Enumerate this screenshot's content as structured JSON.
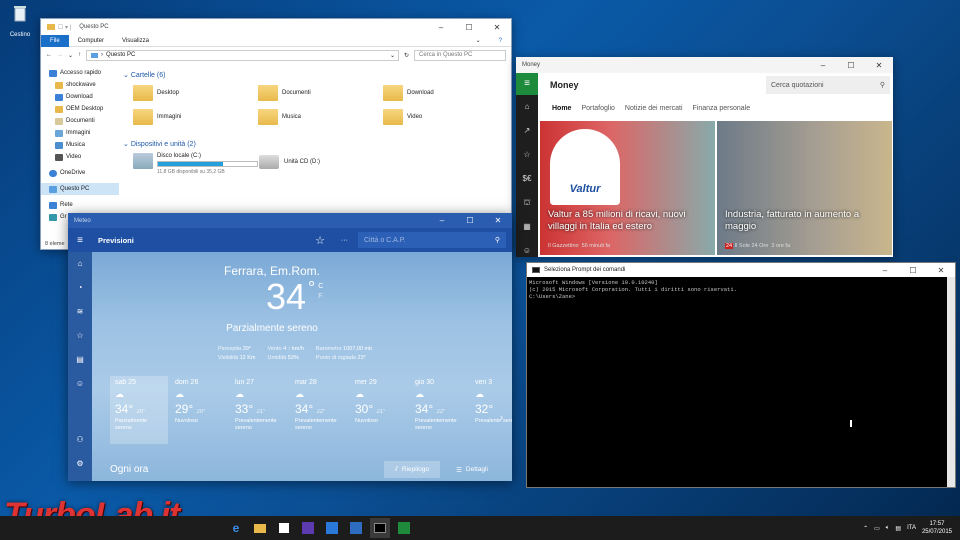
{
  "desktop": {
    "recycle_label": "Cestino"
  },
  "explorer": {
    "title": "Questo PC",
    "tabs": [
      "File",
      "Computer",
      "Visualizza"
    ],
    "address": "Questo PC",
    "search_placeholder": "Cerca in Questo PC",
    "nav": [
      "Accesso rapido",
      "shockwave",
      "Download",
      "OEM Desktop",
      "Documenti",
      "Immagini",
      "Musica",
      "Video",
      "OneDrive",
      "Questo PC",
      "Rete",
      "Gr"
    ],
    "folders_header": "Cartelle (6)",
    "folders": [
      "Desktop",
      "Documenti",
      "Download",
      "Immagini",
      "Musica",
      "Video"
    ],
    "devices_header": "Dispositivi e unità (2)",
    "disk_name": "Disco locale (C:)",
    "disk_space": "11,8 GB disponibili su 35,2 GB",
    "disk_fill": 0.66,
    "cd_name": "Unità CD (D:)",
    "status": "8 eleme"
  },
  "money": {
    "title": "Money",
    "app": "Money",
    "search_placeholder": "Cerca quotazioni",
    "tabs": [
      "Home",
      "Portafoglio",
      "Notizie dei mercati",
      "Finanza personale"
    ],
    "tile1": {
      "caption": "Valtur a 85 milioni di ricavi, nuovi villaggi in Italia ed estero",
      "source": "Il Gazzettino",
      "time": "56 minuti fa",
      "logo_text": "Valtur"
    },
    "tile2": {
      "caption": "Industria, fatturato in aumento a maggio",
      "source": "Il Sole 24 Ore",
      "time": "3 ore fa",
      "badge": "24"
    }
  },
  "meteo": {
    "title": "Meteo",
    "header": "Previsioni",
    "search_placeholder": "Città o C.A.P.",
    "city": "Ferrara, Em.Rom.",
    "temp": "34",
    "deg": "°",
    "unit_c": "C",
    "unit_f": "F",
    "condition": "Parzialmente sereno",
    "details": {
      "perceived_label": "Percepita",
      "perceived": "39°",
      "wind_label": "Vento",
      "wind": "4 ↑ km/h",
      "barometer_label": "Barometro",
      "barometer": "1007,00 mb",
      "visibility_label": "Visibilità",
      "visibility": "12 Km",
      "humidity_label": "Umidità",
      "humidity": "53%",
      "dew_label": "Punto di rugiada",
      "dew": "23°"
    },
    "days": [
      {
        "name": "sab 25",
        "hi": "34°",
        "lo": "20°",
        "cond": "Parzialmente sereno"
      },
      {
        "name": "dom 26",
        "hi": "29°",
        "lo": "20°",
        "cond": "Nuvoloso"
      },
      {
        "name": "lun 27",
        "hi": "33°",
        "lo": "21°",
        "cond": "Prevalentemente sereno"
      },
      {
        "name": "mar 28",
        "hi": "34°",
        "lo": "22°",
        "cond": "Prevalentemente sereno"
      },
      {
        "name": "mer 29",
        "hi": "30°",
        "lo": "21°",
        "cond": "Nuvoloso"
      },
      {
        "name": "gio 30",
        "hi": "34°",
        "lo": "22°",
        "cond": "Prevalentemente sereno"
      },
      {
        "name": "ven 3",
        "hi": "32°",
        "lo": "",
        "cond": "Prevalente sereno"
      }
    ],
    "hourly": "Ogni ora",
    "summary": "Riepilogo",
    "details_btn": "Dettagli"
  },
  "cmd": {
    "title": "Seleziona Prompt dei comandi",
    "lines": [
      "Microsoft Windows [Versione 10.0.10240]",
      "(c) 2015 Microsoft Corporation. Tutti i diritti sono riservati.",
      "",
      "C:\\Users\\Zane>"
    ]
  },
  "taskbar": {
    "time": "17:57",
    "date": "25/07/2015",
    "lang": "ITA"
  },
  "watermark": "TurboLab.it"
}
